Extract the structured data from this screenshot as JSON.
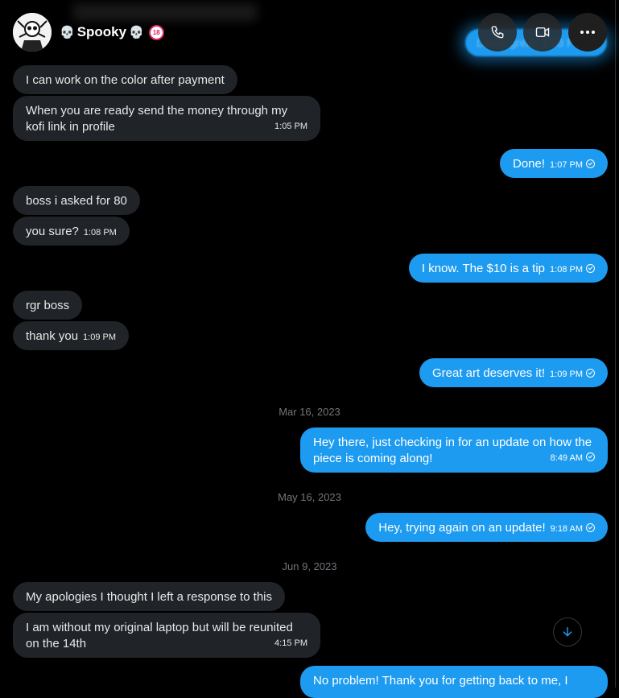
{
  "header": {
    "name": "Spooky",
    "name_prefix_icon": "skull-icon",
    "name_suffix_icon": "skull-icon",
    "badge_icon": "no-under-18-icon",
    "ghost_text": "Looks great! 1:03 PM"
  },
  "messages": [
    {
      "dir": "in",
      "text": "I can work on the color after payment"
    },
    {
      "dir": "in",
      "text": "When you are ready send the money through my kofi link in profile",
      "time": "1:05 PM"
    },
    {
      "dir": "out",
      "text": "Done!",
      "time": "1:07 PM"
    },
    {
      "dir": "in",
      "text": "boss i asked for 80"
    },
    {
      "dir": "in",
      "text": "you sure?",
      "time": "1:08 PM"
    },
    {
      "dir": "out",
      "text": "I know. The $10 is a tip",
      "time": "1:08 PM"
    },
    {
      "dir": "in",
      "text": "rgr boss"
    },
    {
      "dir": "in",
      "text": "thank you",
      "time": "1:09 PM"
    },
    {
      "dir": "out",
      "text": "Great art deserves it!",
      "time": "1:09 PM"
    },
    {
      "dir": "out",
      "text": "Hey there, just checking in for an update on how the piece is coming along!",
      "time": "8:49 AM"
    },
    {
      "dir": "out",
      "text": "Hey, trying again on an update!",
      "time": "9:18 AM"
    },
    {
      "dir": "in",
      "text": "My apologies I thought I left a response to this"
    },
    {
      "dir": "in",
      "text": "I am without my original laptop but will be reunited on the 14th",
      "time": "4:15 PM"
    },
    {
      "dir": "out",
      "text": "No problem! Thank you for getting back to me, I"
    }
  ],
  "dates": [
    "Mar 16, 2023",
    "May 16, 2023",
    "Jun 9, 2023"
  ],
  "icons": {
    "call": "phone-icon",
    "video": "video-camera-icon",
    "more": "more-options-icon",
    "scroll": "arrow-down-icon",
    "read": "read-receipt-icon"
  },
  "colors": {
    "accent": "#1d9bf0",
    "incoming": "#202327",
    "background": "#000000"
  }
}
